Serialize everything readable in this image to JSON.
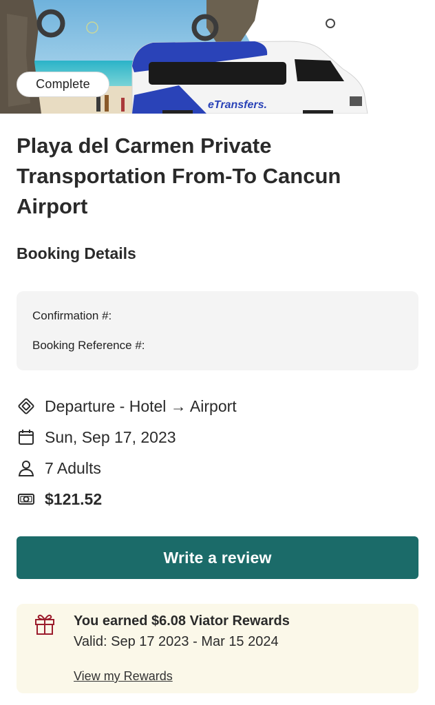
{
  "hero": {
    "status": "Complete",
    "brand_text": "eTransfers."
  },
  "product": {
    "title": "Playa del Carmen Private Transportation From-To Cancun Airport"
  },
  "booking": {
    "heading": "Booking Details",
    "confirmation_label": "Confirmation #:",
    "reference_label": "Booking Reference #:"
  },
  "details": {
    "route": "Departure - Hotel → Airport",
    "date": "Sun, Sep 17, 2023",
    "travelers": "7 Adults",
    "price": "$121.52"
  },
  "actions": {
    "review_label": "Write a review"
  },
  "rewards": {
    "title": "You earned $6.08 Viator Rewards",
    "valid": "Valid: Sep 17 2023 - Mar 15 2024",
    "link": "View my Rewards"
  },
  "colors": {
    "primary_button": "#1b6b69",
    "rewards_bg": "#fbf8e9",
    "gift_icon": "#9b1c2c"
  },
  "icons": [
    "ticket-icon",
    "calendar-icon",
    "person-icon",
    "money-icon",
    "gift-icon"
  ]
}
